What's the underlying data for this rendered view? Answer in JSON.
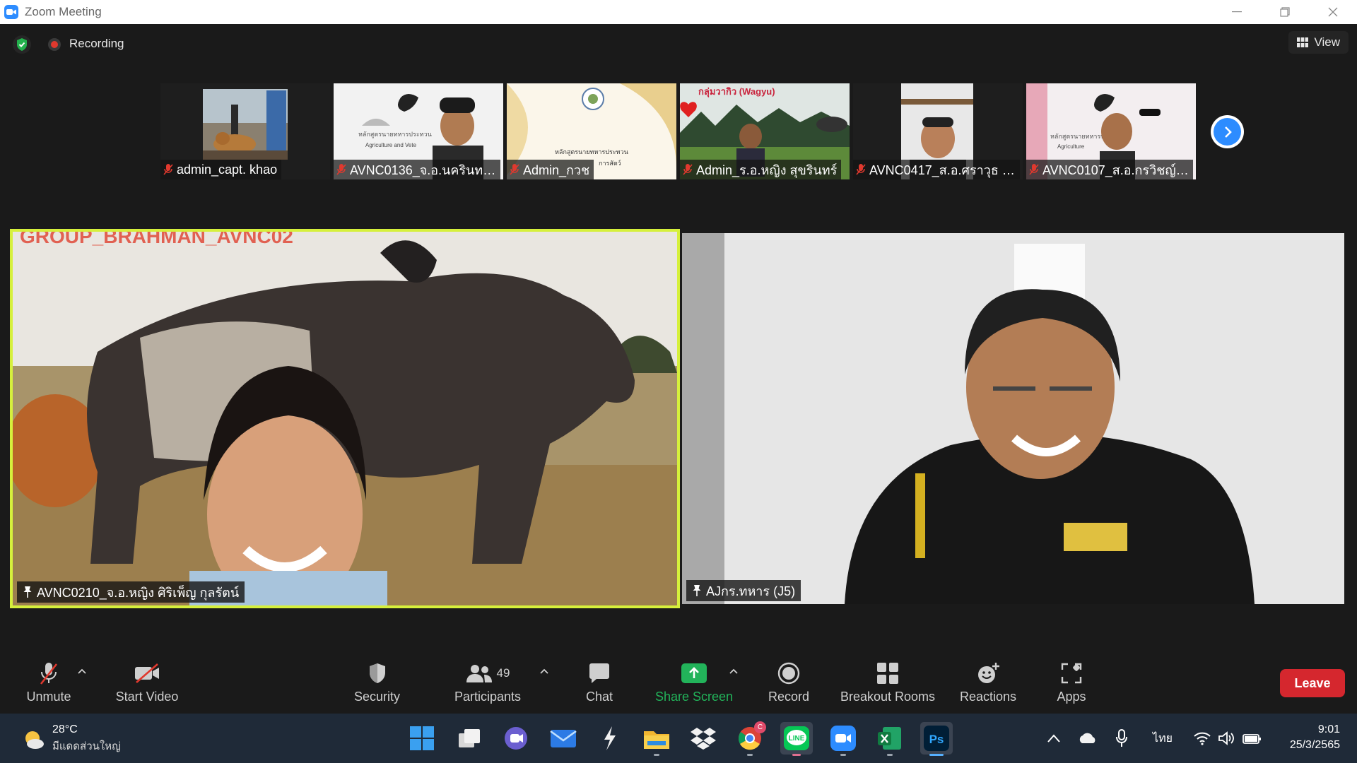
{
  "window": {
    "title": "Zoom Meeting"
  },
  "top": {
    "recording_label": "Recording",
    "view_label": "View"
  },
  "thumbnails": [
    {
      "name": "admin_capt. khao",
      "scene": "room-dog"
    },
    {
      "name": "AVNC0136_จ.อ.นครินทร์ ...",
      "scene": "slide-man",
      "slide_text": "หลักสูตรนายทหารประทวน",
      "slide_sub": "Agriculture and Vete"
    },
    {
      "name": "Admin_กวช",
      "scene": "gold-slide",
      "slide_text": "หลักสูตรนายทหารประทวน",
      "slide_sub": "การสัตว์"
    },
    {
      "name": "Admin_ร.อ.หญิง สุขรินทร์",
      "scene": "wagyu",
      "slide_text": "กลุ่มวากิว (Wagyu)"
    },
    {
      "name": "AVNC0417_ส.อ.ศราวุธ สุ...",
      "scene": "man-wall"
    },
    {
      "name": "AVNC0107_ส.อ.กรวิชญ์ ...",
      "scene": "slide-man2",
      "slide_text": "หลักสูตรนายทหารประทวน",
      "slide_sub": "Agriculture"
    }
  ],
  "videos": {
    "left": {
      "name": "AVNC0210_จ.อ.หญิง ศิริเพ็ญ กุลรัตน์",
      "overlay_text": "GROUP_BRAHMAN_AVNC02"
    },
    "right": {
      "name": "AJกร.ทหาร (J5)"
    }
  },
  "toolbar": {
    "unmute": "Unmute",
    "start_video": "Start Video",
    "security": "Security",
    "participants": "Participants",
    "participants_count": "49",
    "chat": "Chat",
    "share_screen": "Share Screen",
    "record": "Record",
    "breakout_rooms": "Breakout Rooms",
    "reactions": "Reactions",
    "apps": "Apps",
    "leave": "Leave"
  },
  "taskbar": {
    "temperature": "28°C",
    "weather_desc": "มีแดดส่วนใหญ่",
    "language": "ไทย",
    "time": "9:01",
    "date": "25/3/2565",
    "chrome_badge": "C"
  },
  "colors": {
    "accent": "#2d8cff",
    "leave": "#d5272e",
    "share": "#22b35a",
    "active_speaker": "#d6f03c"
  }
}
